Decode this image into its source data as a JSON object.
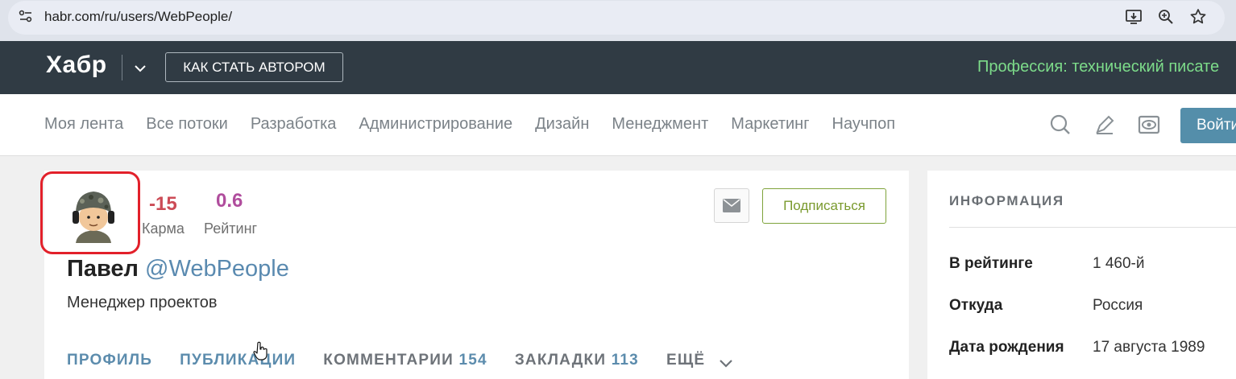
{
  "browser": {
    "url": "habr.com/ru/users/WebPeople/",
    "icons": [
      "site-settings-icon",
      "install-app-icon",
      "zoom-icon",
      "bookmark-star-icon"
    ]
  },
  "header": {
    "logo": "Хабр",
    "author_button": "КАК СТАТЬ АВТОРОМ",
    "promo": "Профессия: технический писате"
  },
  "nav": {
    "links": [
      "Моя лента",
      "Все потоки",
      "Разработка",
      "Администрирование",
      "Дизайн",
      "Менеджмент",
      "Маркетинг",
      "Научпоп"
    ],
    "icons": [
      "search-icon",
      "pen-icon",
      "eye-icon"
    ],
    "login": "Войти"
  },
  "profile": {
    "karma_value": "-15",
    "karma_label": "Карма",
    "rating_value": "0.6",
    "rating_label": "Рейтинг",
    "subscribe": "Подписаться",
    "name": "Павел",
    "handle": "@WebPeople",
    "title": "Менеджер проектов"
  },
  "tabs": [
    {
      "label": "ПРОФИЛЬ",
      "count": ""
    },
    {
      "label": "ПУБЛИКАЦИИ",
      "count": ""
    },
    {
      "label": "КОММЕНТАРИИ",
      "count": "154"
    },
    {
      "label": "ЗАКЛАДКИ",
      "count": "113"
    },
    {
      "label": "ЕЩЁ",
      "count": ""
    }
  ],
  "info": {
    "heading": "ИНФОРМАЦИЯ",
    "rows": [
      {
        "key": "В рейтинге",
        "value": "1 460-й"
      },
      {
        "key": "Откуда",
        "value": "Россия"
      },
      {
        "key": "Дата рождения",
        "value": "17 августа 1989"
      }
    ]
  },
  "colors": {
    "header_bg": "#303b44",
    "promo_green": "#7ddc8a",
    "karma_red": "#cc4b56",
    "rating_purple": "#b04d9d",
    "link_blue": "#5c8cad",
    "login_blue": "#548eaa",
    "subscribe_green": "#7a9a2e",
    "highlight_red": "#e2202a"
  }
}
